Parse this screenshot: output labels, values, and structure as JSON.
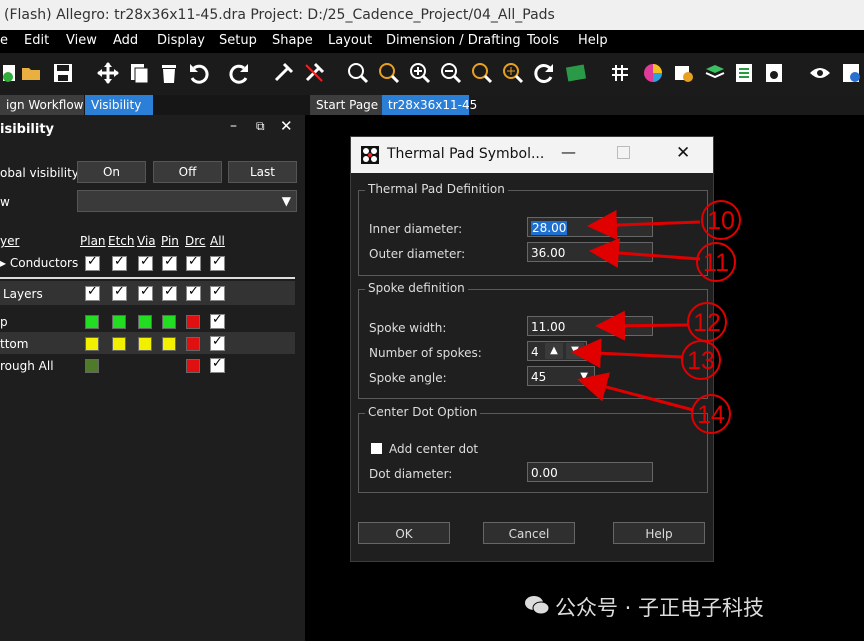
{
  "window": {
    "title": "(Flash) Allegro: tr28x36x11-45.dra  Project: D:/25_Cadence_Project/04_All_Pads"
  },
  "menu": [
    "e",
    "Edit",
    "View",
    "Add",
    "Display",
    "Setup",
    "Shape",
    "Layout",
    "Dimension / Drafting",
    "Tools",
    "Help"
  ],
  "left_tabs": {
    "workflow": "ign Workflow",
    "visibility": "Visibility"
  },
  "visibility_panel": {
    "title": "isibility",
    "global_visibility_label": "obal visibility",
    "on_label": "On",
    "off_label": "Off",
    "last_label": "Last",
    "view_label": "w",
    "columns": {
      "layer": "yer",
      "plan": "Plan",
      "etch": "Etch",
      "via": "Via",
      "pin": "Pin",
      "drc": "Drc",
      "all": "All"
    },
    "rows": {
      "conductors": "Conductors",
      "layers": "Layers",
      "top": "p",
      "bottom": "ttom",
      "through": "rough All"
    },
    "colors": {
      "green": "#22dd22",
      "yellow": "#f0f000",
      "red": "#e01010",
      "olive": "#4f7a2a"
    }
  },
  "canvas_tabs": {
    "start": "Start Page",
    "design": "tr28x36x11-45"
  },
  "dialog": {
    "title": "Thermal Pad Symbol...",
    "thermal_group": "Thermal Pad Definition",
    "inner_label": "Inner diameter:",
    "inner_value": "28.00",
    "outer_label": "Outer diameter:",
    "outer_value": "36.00",
    "spoke_group": "Spoke definition",
    "spoke_width_label": "Spoke width:",
    "spoke_width_value": "11.00",
    "num_spokes_label": "Number of spokes:",
    "num_spokes_value": "4",
    "spoke_angle_label": "Spoke angle:",
    "spoke_angle_value": "45",
    "center_group": "Center Dot Option",
    "add_center_label": "Add center dot",
    "dot_diameter_label": "Dot diameter:",
    "dot_diameter_value": "0.00",
    "ok": "OK",
    "cancel": "Cancel",
    "help": "Help"
  },
  "annotations": [
    "10",
    "11",
    "12",
    "13",
    "14"
  ],
  "watermark": "公众号 · 子正电子科技"
}
